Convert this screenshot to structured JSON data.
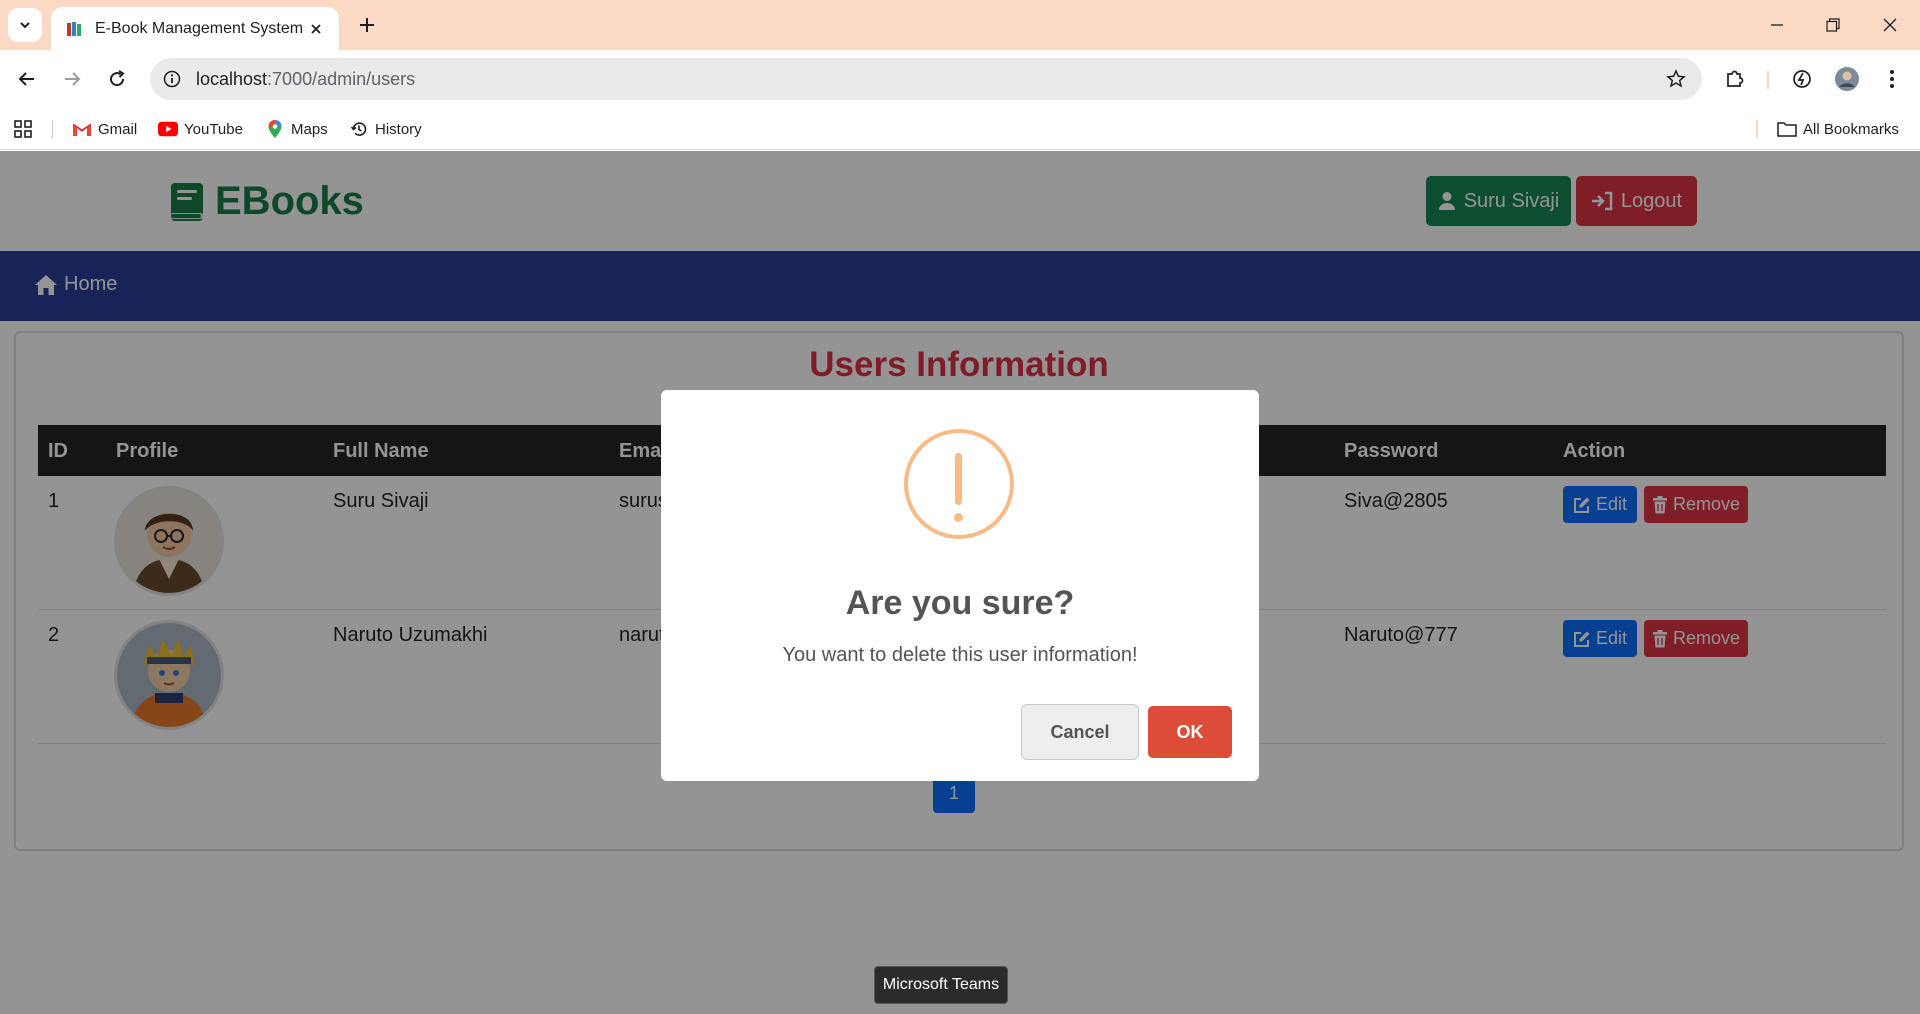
{
  "browser": {
    "tab_title": "E-Book Management System",
    "url_host": "localhost",
    "url_rest": ":7000/admin/users",
    "bookmarks": [
      {
        "label": "Gmail",
        "icon": "gmail-icon"
      },
      {
        "label": "YouTube",
        "icon": "youtube-icon"
      },
      {
        "label": "Maps",
        "icon": "maps-icon"
      },
      {
        "label": "History",
        "icon": "history-icon"
      }
    ],
    "all_bookmarks_label": "All Bookmarks"
  },
  "header": {
    "brand": "EBooks",
    "user_button": "Suru Sivaji",
    "logout_button": "Logout"
  },
  "nav": {
    "home_label": "Home"
  },
  "users": {
    "title": "Users Information",
    "columns": [
      "ID",
      "Profile",
      "Full Name",
      "Emai",
      "Password",
      "Action"
    ],
    "rows": [
      {
        "id": "1",
        "full_name": "Suru Sivaji",
        "email": "surus",
        "password": "Siva@2805",
        "edit": "Edit",
        "remove": "Remove"
      },
      {
        "id": "2",
        "full_name": "Naruto Uzumakhi",
        "email": "narut",
        "password": "Naruto@777",
        "edit": "Edit",
        "remove": "Remove"
      }
    ],
    "page_number": "1"
  },
  "dialog": {
    "title": "Are you sure?",
    "text": "You want to delete this user information!",
    "cancel": "Cancel",
    "ok": "OK"
  },
  "tooltip": "Microsoft Teams",
  "colors": {
    "tabbar": "#fbd9c5",
    "brand": "#1a7a48",
    "navbar": "#2a3d97",
    "title_red": "#dc2f45",
    "warning": "#f8bb86",
    "ok_button": "#dd4b39"
  }
}
